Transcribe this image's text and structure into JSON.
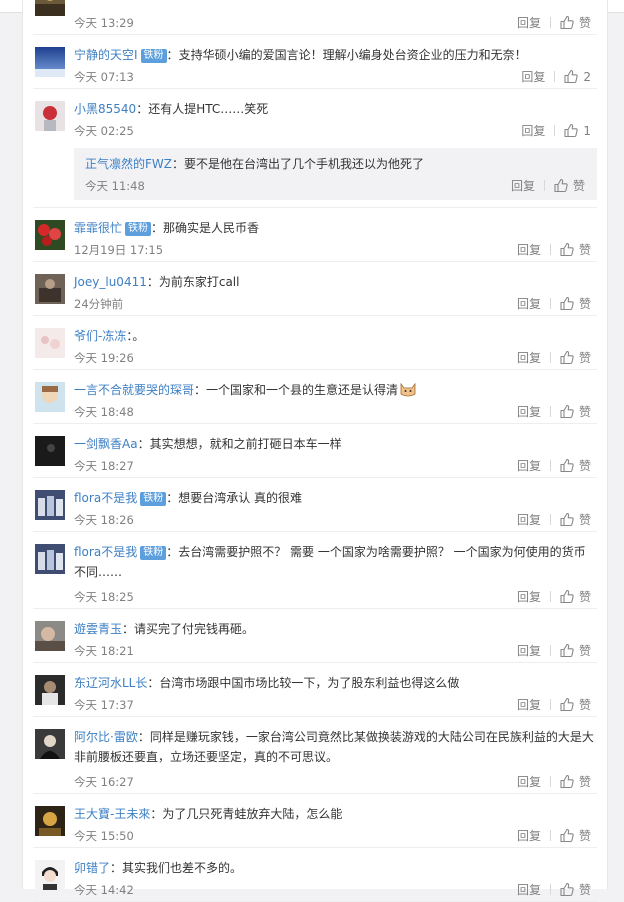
{
  "actions": {
    "reply": "回复",
    "like": "赞"
  },
  "comments": [
    {
      "user": "",
      "badge": "",
      "text": "",
      "time": "今天 13:29",
      "likes": "赞"
    },
    {
      "user": "宁静的天空I",
      "badge": "铁粉",
      "text": "支持华硕小编的爱国言论！理解小编身处台资企业的压力和无奈！",
      "time": "今天 07:13",
      "likes": "2"
    },
    {
      "user": "小黑85540",
      "badge": "",
      "text": "还有人提HTC……笑死",
      "time": "今天 02:25",
      "likes": "1"
    },
    {
      "user": "霏霏很忙",
      "badge": "铁粉",
      "text": "那确实是人民币香",
      "time": "12月19日 17:15",
      "likes": "赞"
    },
    {
      "user": "Joey_lu0411",
      "badge": "",
      "text": "为前东家打call",
      "time": "24分钟前",
      "likes": "赞"
    },
    {
      "user": "爷们-冻冻",
      "badge": "",
      "text": "。",
      "time": "今天 19:26",
      "likes": "赞"
    },
    {
      "user": "一言不合就要哭的琛哥",
      "badge": "",
      "text": "一个国家和一个县的生意还是认得清",
      "time": "今天 18:48",
      "likes": "赞"
    },
    {
      "user": "一剑飘香Aa",
      "badge": "",
      "text": "其实想想，就和之前打砸日本车一样",
      "time": "今天 18:27",
      "likes": "赞"
    },
    {
      "user": "flora不是我",
      "badge": "铁粉",
      "text": "想要台湾承认  真的很难",
      "time": "今天 18:26",
      "likes": "赞"
    },
    {
      "user": "flora不是我",
      "badge": "铁粉",
      "text": "去台湾需要护照不？  需要   一个国家为啥需要护照？  一个国家为何使用的货币不同……",
      "time": "今天 18:25",
      "likes": "赞"
    },
    {
      "user": "遊雲青玉",
      "badge": "",
      "text": "请买完了付完钱再砸。",
      "time": "今天 18:21",
      "likes": "赞"
    },
    {
      "user": "东辽河水LL长",
      "badge": "",
      "text": "台湾市场跟中国市场比较一下，为了股东利益也得这么做",
      "time": "今天 17:37",
      "likes": "赞"
    },
    {
      "user": "阿尔比·雷欧",
      "badge": "",
      "text": "同样是赚玩家钱，一家台湾公司竟然比某做换装游戏的大陆公司在民族利益的大是大非前腰板还要直，立场还要坚定，真的不可思议。",
      "time": "今天 16:27",
      "likes": "赞"
    },
    {
      "user": "王大寶-王未來",
      "badge": "",
      "text": "为了几只死青蛙放弃大陆，怎么能",
      "time": "今天 15:50",
      "likes": "赞"
    },
    {
      "user": "卯错了",
      "badge": "",
      "text": "其实我们也差不多的。",
      "time": "今天 14:42",
      "likes": "赞"
    }
  ],
  "sub_reply": {
    "user": "正气凛然的FWZ",
    "text": "要不是他在台湾出了几个手机我还以为他死了",
    "time": "今天 11:48",
    "likes": "赞"
  }
}
